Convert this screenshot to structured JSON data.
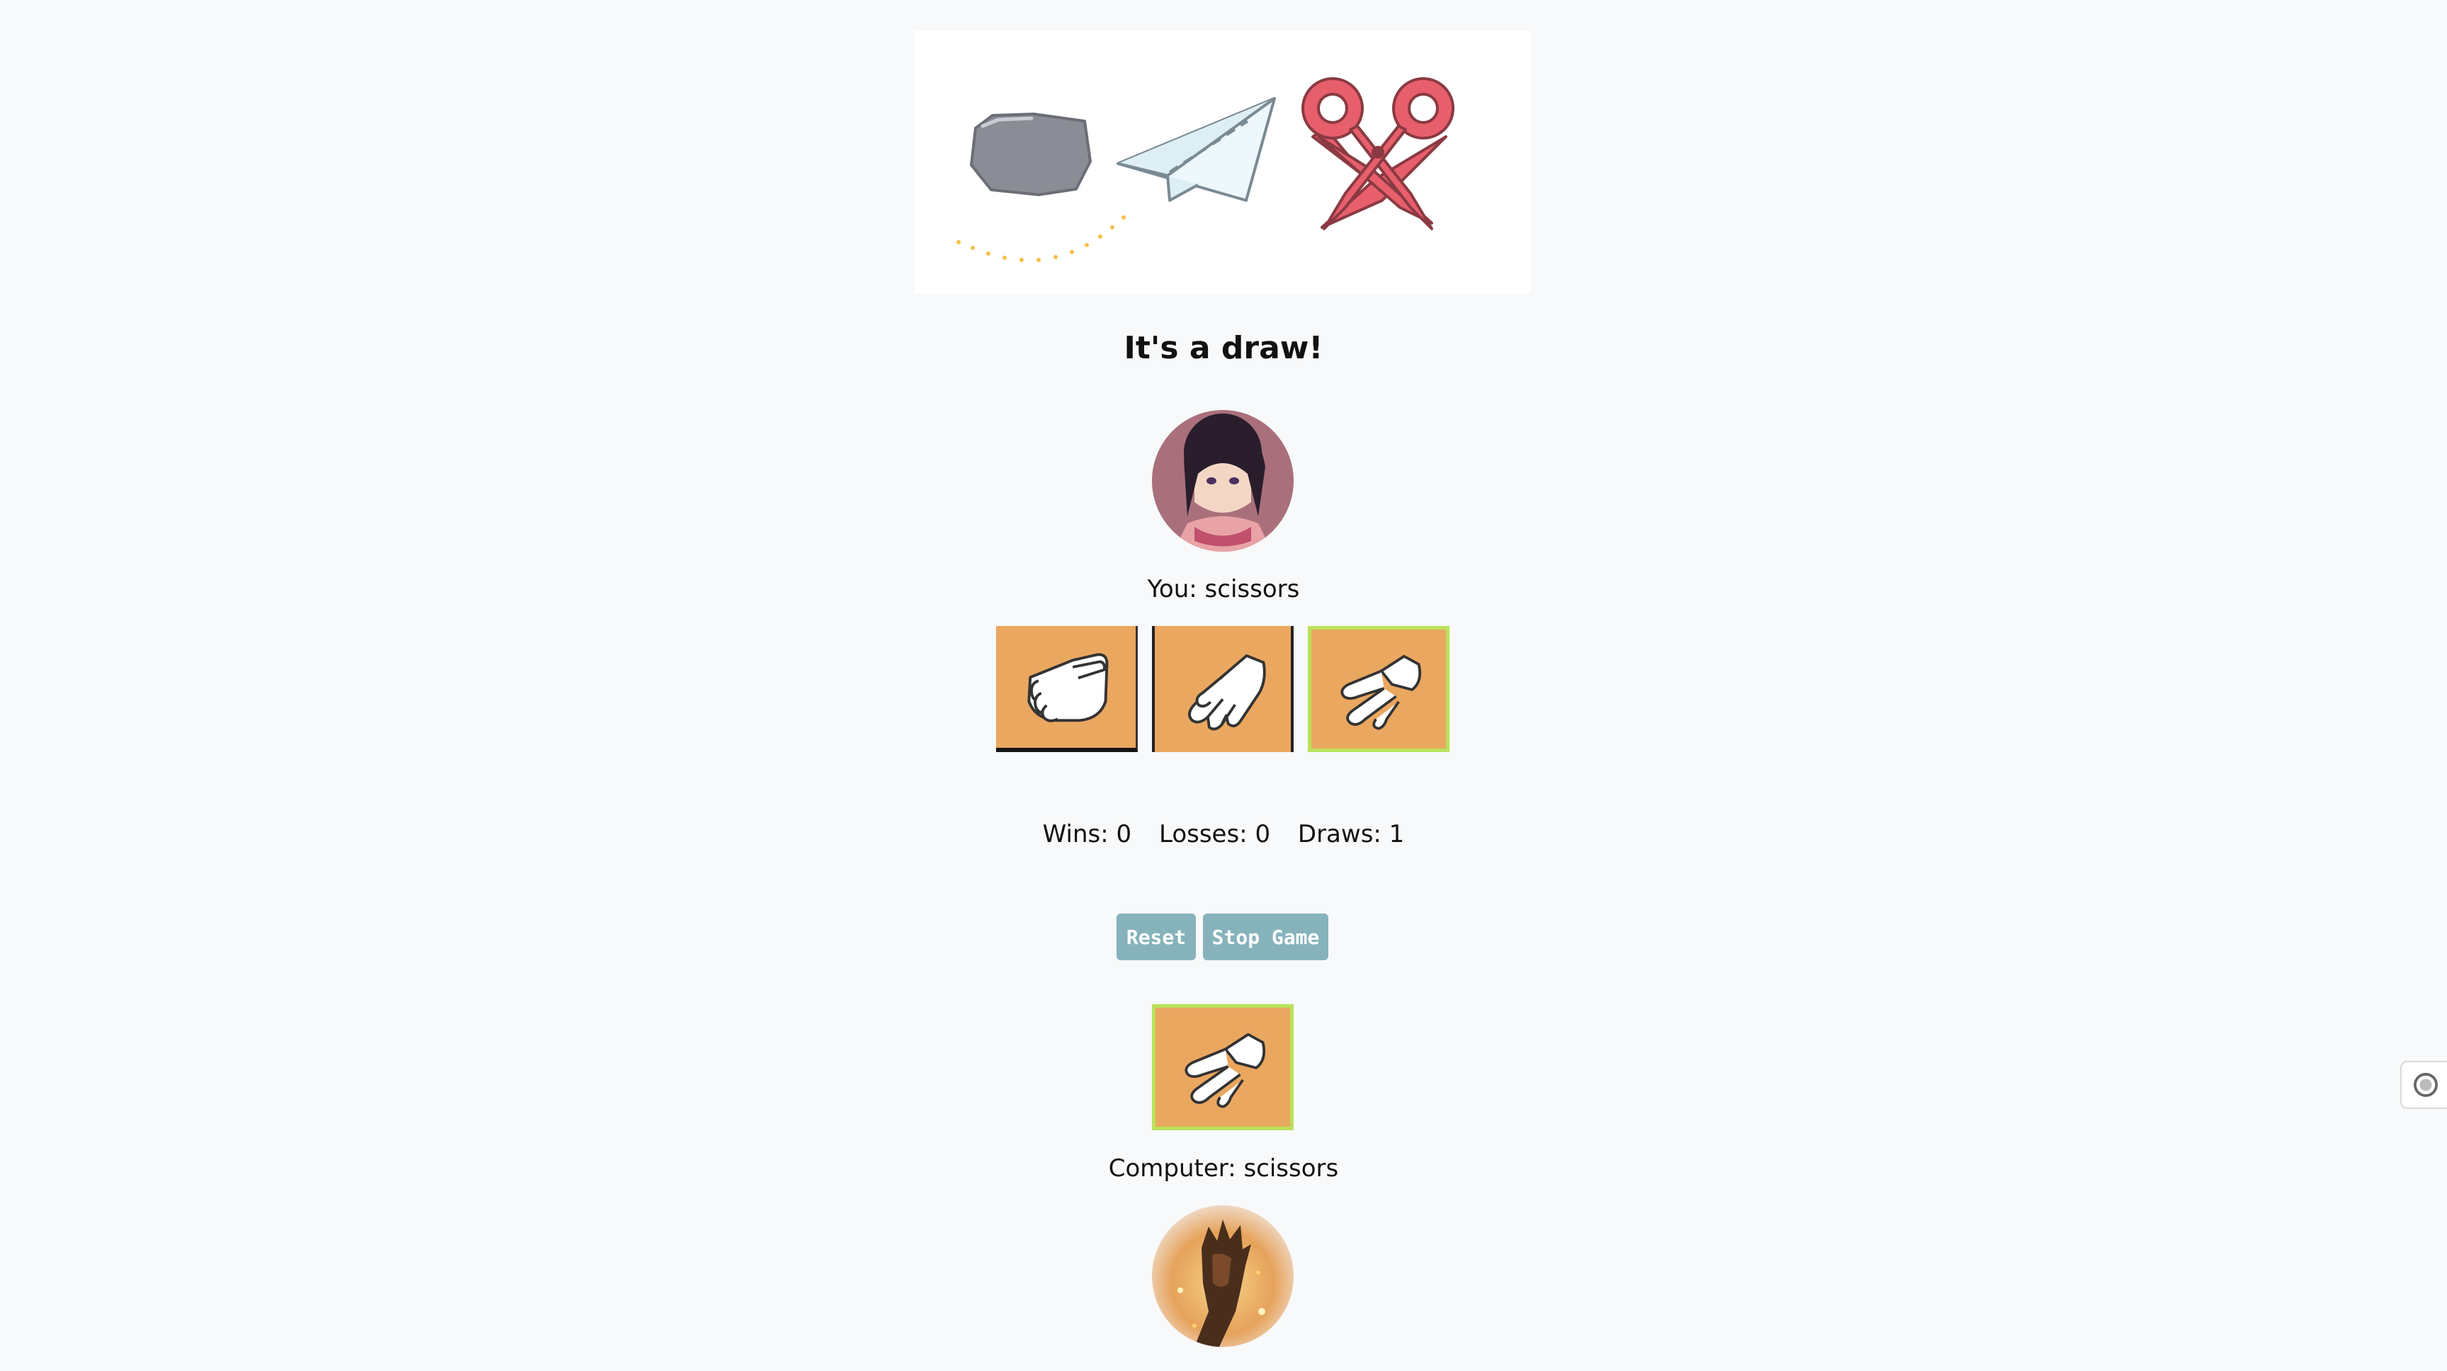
{
  "banner": {
    "images": [
      "rock-icon",
      "paper-plane-icon",
      "scissors-icon"
    ]
  },
  "result": {
    "text": "It's a draw!"
  },
  "player": {
    "label": "You: scissors",
    "avatar": "anime-girl-avatar",
    "selected": "scissors"
  },
  "choices": [
    {
      "name": "rock",
      "icon": "rock-hand-icon"
    },
    {
      "name": "paper",
      "icon": "paper-hand-icon"
    },
    {
      "name": "scissors",
      "icon": "scissors-hand-icon"
    }
  ],
  "score": {
    "wins": "Wins: 0",
    "losses": "Losses: 0",
    "draws": "Draws: 1"
  },
  "buttons": {
    "reset": "Reset",
    "stop": "Stop Game"
  },
  "computer": {
    "label": "Computer: scissors",
    "avatar": "fire-warrior-avatar",
    "choice": "scissors"
  },
  "colors": {
    "tile": "#eaa760",
    "selected_border": "#b9e25a",
    "button": "#86b3bb",
    "background": "#f8f9fa"
  }
}
